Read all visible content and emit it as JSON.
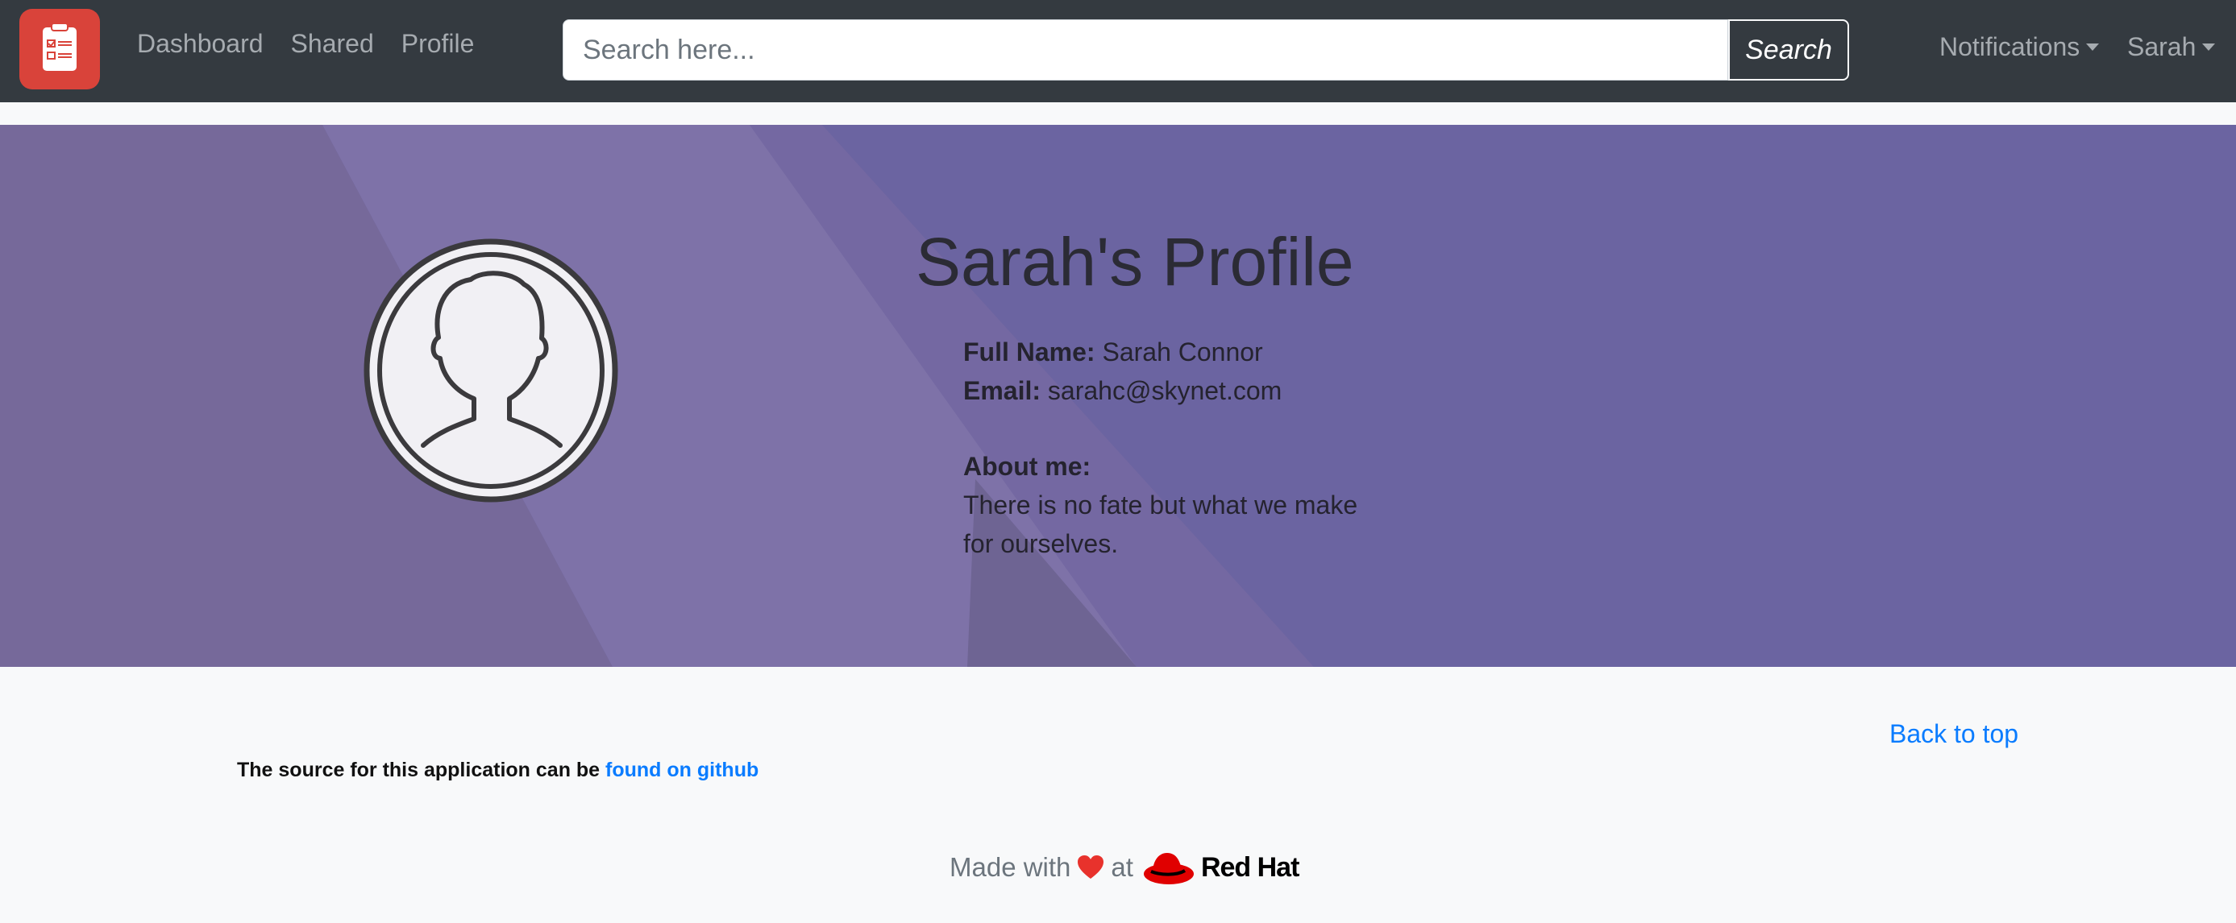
{
  "nav": {
    "links": [
      "Dashboard",
      "Shared",
      "Profile"
    ],
    "search_placeholder": "Search here...",
    "search_button": "Search",
    "notifications": "Notifications",
    "user": "Sarah"
  },
  "profile": {
    "title": "Sarah's Profile",
    "full_name_label": "Full Name:",
    "full_name": "Sarah Connor",
    "email_label": "Email:",
    "email": "sarahc@skynet.com",
    "about_label": "About me:",
    "about_text": "There is no fate but what we make for ourselves."
  },
  "footer": {
    "back_to_top": "Back to top",
    "source_text": "The source for this application can be",
    "source_link": "found on github",
    "made_with": "Made with",
    "at": "at",
    "brand": "Red Hat"
  },
  "colors": {
    "navbar": "#343a40",
    "brand_red": "#d9433a",
    "hero_purple": "#6d64a0",
    "link_blue": "#0a7cff"
  },
  "icons": [
    "clipboard-checklist-icon",
    "avatar-silhouette-icon",
    "heart-icon",
    "redhat-hat-icon"
  ]
}
